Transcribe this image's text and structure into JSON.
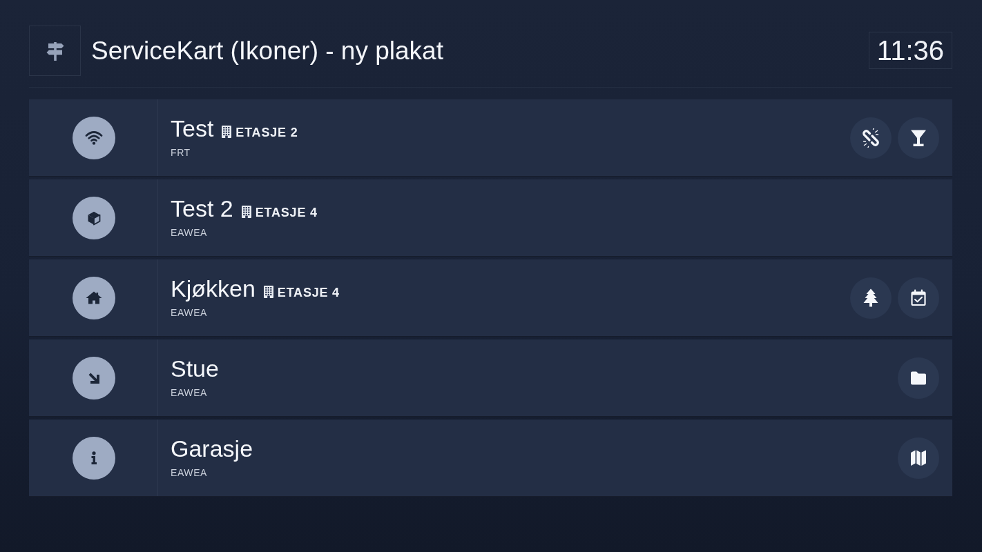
{
  "header": {
    "title": "ServiceKart (Ikoner) - ny plakat",
    "clock": "11:36"
  },
  "rows": [
    {
      "kind": "wifi",
      "name": "Test",
      "floor": "ETASJE 2",
      "subtitle": "FRT",
      "actions": [
        {
          "kind": "unlink"
        },
        {
          "kind": "cocktail"
        }
      ]
    },
    {
      "kind": "cube",
      "name": "Test 2",
      "floor": "ETASJE 4",
      "subtitle": "EAWEA"
    },
    {
      "kind": "home",
      "name": "Kjøkken",
      "floor": "ETASJE 4",
      "subtitle": "EAWEA",
      "actions": [
        {
          "kind": "tree"
        },
        {
          "kind": "calendar"
        }
      ]
    },
    {
      "kind": "arrow",
      "name": "Stue",
      "subtitle": "EAWEA",
      "actions": [
        {
          "kind": "folder"
        }
      ]
    },
    {
      "kind": "info",
      "name": "Garasje",
      "subtitle": "EAWEA",
      "actions": [
        {
          "kind": "map"
        }
      ]
    }
  ]
}
